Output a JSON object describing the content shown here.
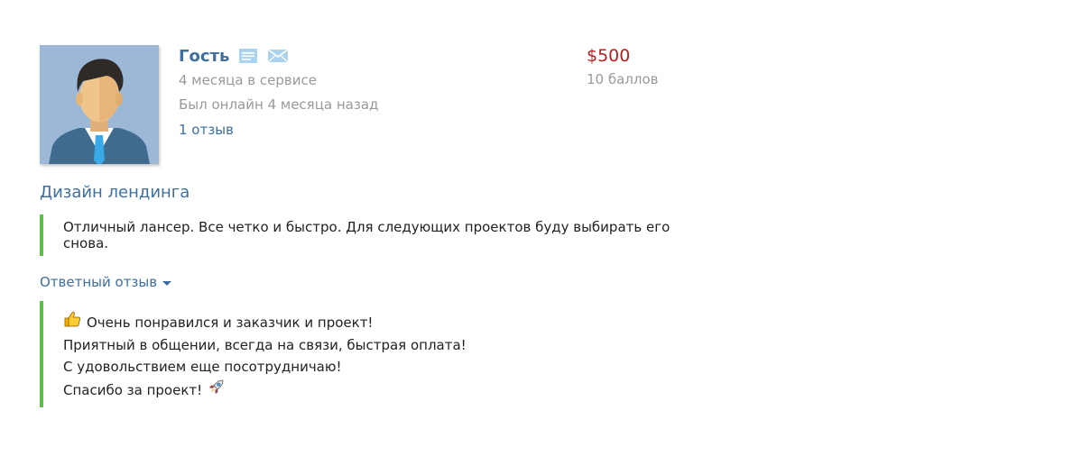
{
  "user": {
    "name": "Гость",
    "service_time": "4 месяца в сервисе",
    "last_online": "Был онлайн 4 месяца назад",
    "reviews_link": "1 отзыв",
    "icons": [
      "document-icon",
      "envelope-icon"
    ]
  },
  "payment": {
    "price": "$500",
    "points": "10 баллов"
  },
  "project": {
    "title": "Дизайн лендинга"
  },
  "review": {
    "text": "Отличный лансер. Все четко и быстро. Для следующих проектов буду выбирать его снова."
  },
  "reply": {
    "toggle_label": "Ответный отзыв",
    "lines": [
      "Очень понравился и заказчик и проект!",
      "Приятный в общении, всегда на связи, быстрая оплата!",
      "С удовольствием еще посотрудничаю!",
      "Спасибо за проект!"
    ],
    "emojis": [
      "thumbs-up-icon",
      "rocket-icon"
    ]
  },
  "colors": {
    "link": "#3e6f9e",
    "price": "#b22222",
    "muted": "#9a9a9a",
    "accent_border": "#5cbf4a"
  }
}
